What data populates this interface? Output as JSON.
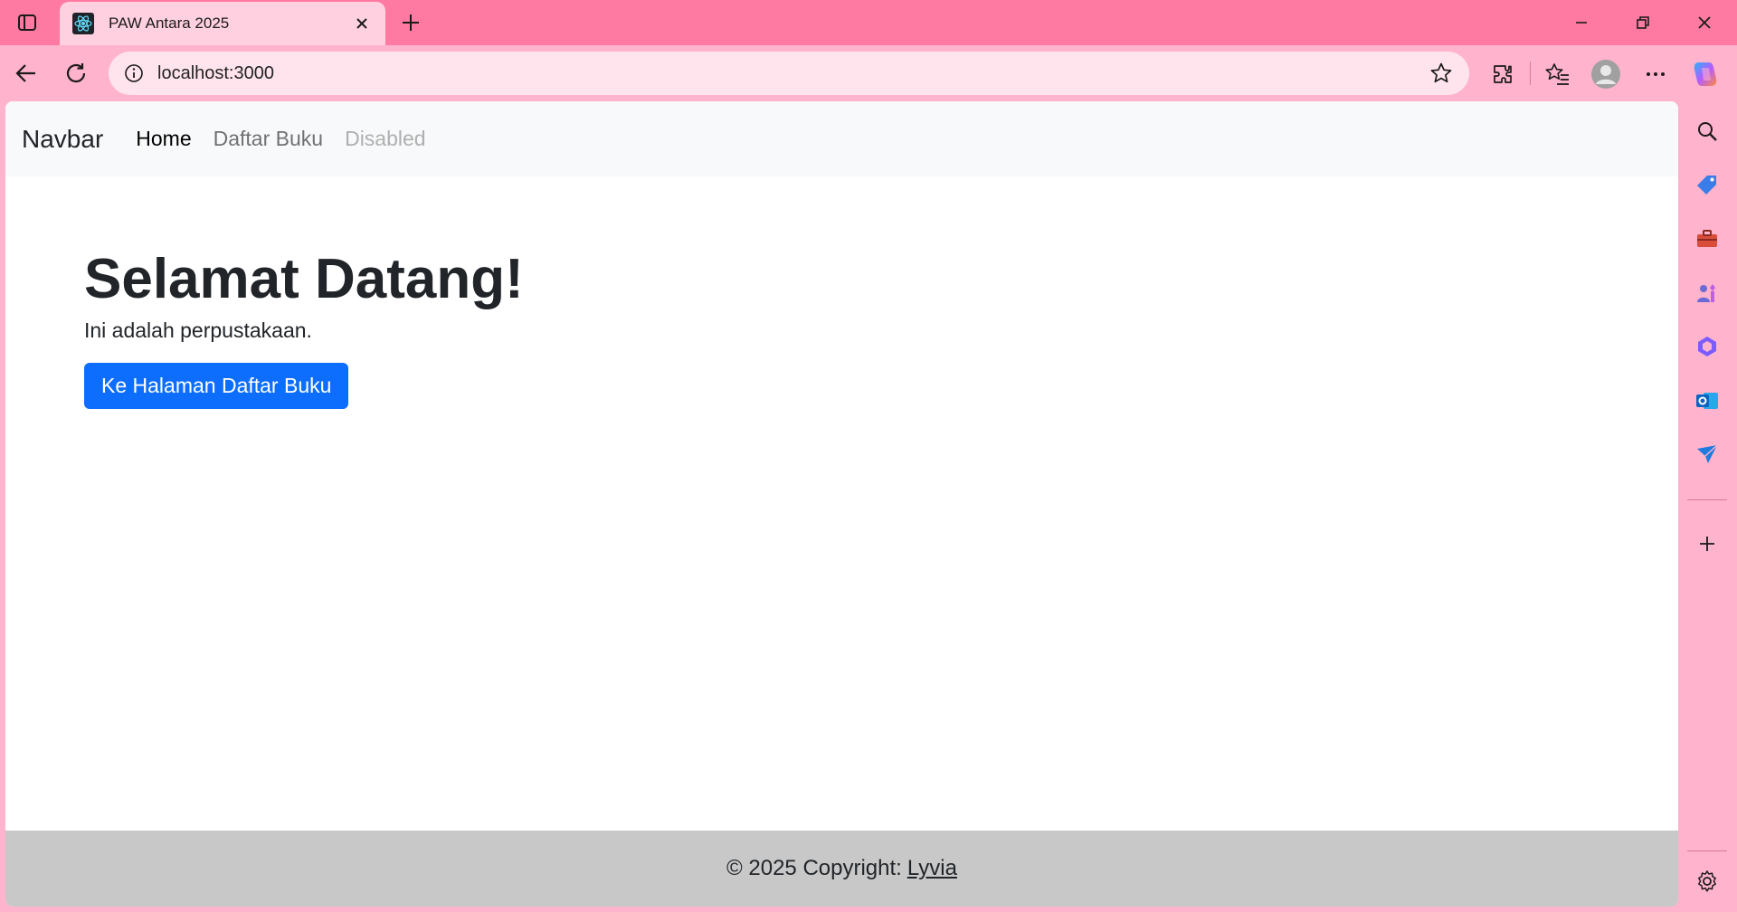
{
  "browser": {
    "tab_title": "PAW Antara 2025",
    "url": "localhost:3000",
    "tab_favicon": "react-icon"
  },
  "navbar": {
    "brand": "Navbar",
    "links": [
      {
        "label": "Home",
        "state": "active"
      },
      {
        "label": "Daftar Buku",
        "state": "normal"
      },
      {
        "label": "Disabled",
        "state": "disabled"
      }
    ]
  },
  "hero": {
    "heading": "Selamat Datang!",
    "subtitle": "Ini adalah perpustakaan.",
    "button_label": "Ke Halaman Daftar Buku"
  },
  "footer": {
    "text": "© 2025 Copyright:",
    "link": "Lyvia"
  },
  "colors": {
    "titlebar": "#ff7aa2",
    "toolbar": "#ffb3cc",
    "primary_button": "#0d6efd",
    "footer_bg": "#c8c8c8",
    "navbar_bg": "#f8f9fa"
  },
  "sidebar_icons": [
    "search-icon",
    "tag-icon",
    "toolbox-icon",
    "games-icon",
    "copilot-icon",
    "outlook-icon",
    "send-icon",
    "add-icon",
    "settings-icon"
  ]
}
